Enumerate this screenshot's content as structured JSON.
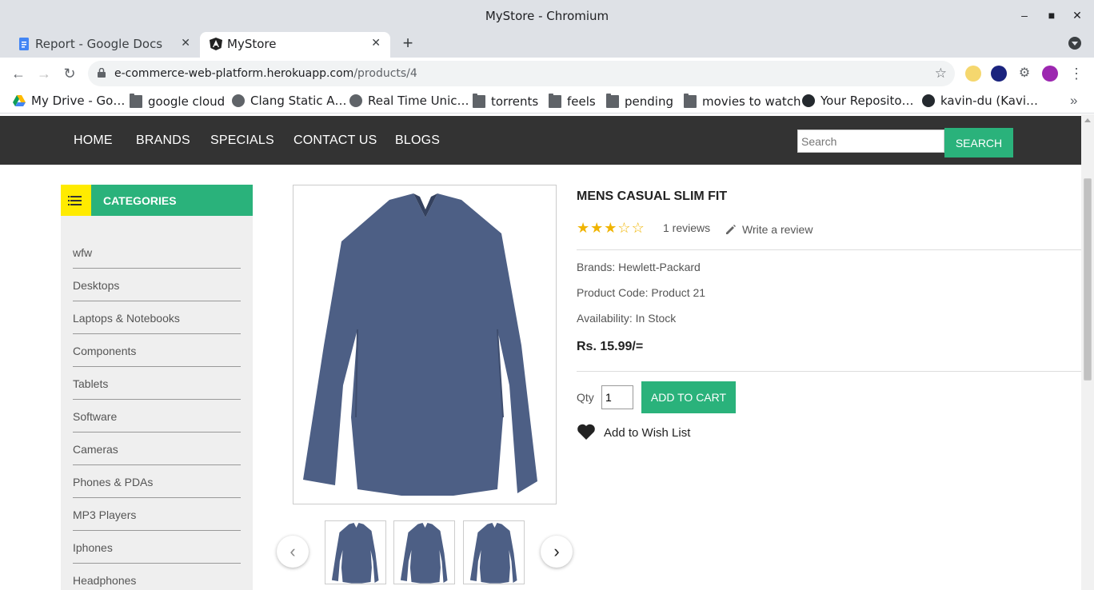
{
  "window": {
    "title": "MyStore - Chromium"
  },
  "tabs": [
    {
      "label": "Report - Google Docs",
      "active": false
    },
    {
      "label": "MyStore",
      "active": true
    }
  ],
  "address_bar": {
    "host": "e-commerce-web-platform.herokuapp.com",
    "path": "/products/4"
  },
  "bookmarks": [
    {
      "label": "My Drive - Go…",
      "icon": "google-drive-icon"
    },
    {
      "label": "google cloud",
      "icon": "folder-icon"
    },
    {
      "label": "Clang Static A…",
      "icon": "globe-icon"
    },
    {
      "label": "Real Time Unic…",
      "icon": "globe-icon"
    },
    {
      "label": "torrents",
      "icon": "folder-icon"
    },
    {
      "label": "feels",
      "icon": "folder-icon"
    },
    {
      "label": "pending",
      "icon": "folder-icon"
    },
    {
      "label": "movies to watch",
      "icon": "folder-icon"
    },
    {
      "label": "Your Reposito…",
      "icon": "github-icon"
    },
    {
      "label": "kavin-du (Kavi…",
      "icon": "github-icon"
    }
  ],
  "site_nav": {
    "links": [
      "HOME",
      "BRANDS",
      "SPECIALS",
      "CONTACT US",
      "BLOGS"
    ],
    "search_placeholder": "Search",
    "search_button": "SEARCH"
  },
  "sidebar": {
    "title": "CATEGORIES",
    "categories": [
      "wfw",
      "Desktops",
      "Laptops & Notebooks",
      "Components",
      "Tablets",
      "Software",
      "Cameras",
      "Phones & PDAs",
      "MP3 Players",
      "Iphones",
      "Headphones"
    ]
  },
  "product": {
    "title": "MENS CASUAL SLIM FIT",
    "rating": 3,
    "rating_max": 5,
    "reviews": "1 reviews",
    "write_review": "Write a review",
    "brand": "Brands: Hewlett-Packard",
    "code": "Product Code: Product 21",
    "availability": "Availability: In Stock",
    "price": "Rs. 15.99/=",
    "qty_label": "Qty",
    "qty_value": "1",
    "add_to_cart": "ADD TO CART",
    "wishlist": "Add to Wish List",
    "color": "#4d5f85"
  },
  "colors": {
    "accent": "#2ab27b",
    "nav_bg": "#333333",
    "icon_box": "#ffeb00"
  }
}
